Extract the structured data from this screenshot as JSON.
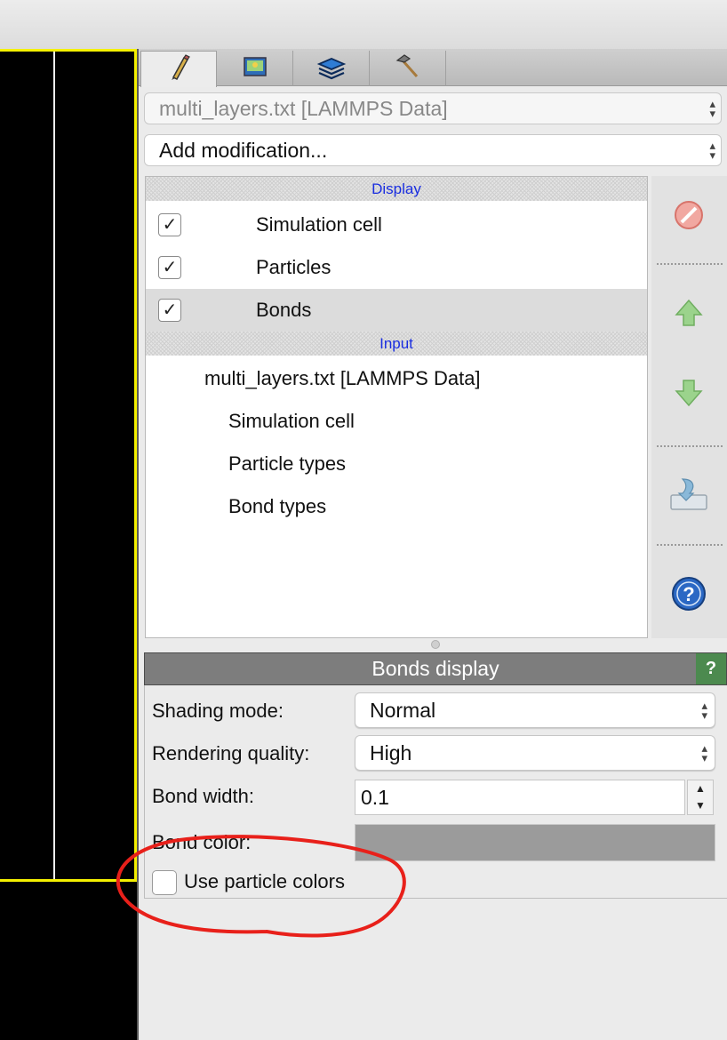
{
  "pipeline_selector": {
    "value": "multi_layers.txt [LAMMPS Data]"
  },
  "modification_selector": {
    "value": "Add modification..."
  },
  "tabs": [
    {
      "name": "pipeline-tab",
      "icon": "pencil-icon"
    },
    {
      "name": "render-tab",
      "icon": "image-icon"
    },
    {
      "name": "overlays-tab",
      "icon": "layers-icon"
    },
    {
      "name": "utilities-tab",
      "icon": "hammer-icon"
    }
  ],
  "pipeline": {
    "display_header": "Display",
    "display_items": [
      {
        "label": "Simulation cell",
        "checked": true
      },
      {
        "label": "Particles",
        "checked": true
      },
      {
        "label": "Bonds",
        "checked": true,
        "selected": true
      }
    ],
    "input_header": "Input",
    "input_source": "multi_layers.txt [LAMMPS Data]",
    "input_items": [
      "Simulation cell",
      "Particle types",
      "Bond types"
    ]
  },
  "side_tools": [
    "delete-icon",
    "move-up-icon",
    "move-down-icon",
    "save-icon",
    "help-icon"
  ],
  "editor": {
    "title": "Bonds display",
    "help_label": "?",
    "shading_label": "Shading mode:",
    "shading_value": "Normal",
    "quality_label": "Rendering quality:",
    "quality_value": "High",
    "width_label": "Bond width:",
    "width_value": "0.1",
    "color_label": "Bond color:",
    "bond_color": "#9b9b9b",
    "use_particle_colors_label": "Use particle colors",
    "use_particle_colors_checked": false
  },
  "colors": {
    "annotation": "#e8201a",
    "viewport_border": "#f4f000",
    "header_link": "#1a2ee0"
  }
}
